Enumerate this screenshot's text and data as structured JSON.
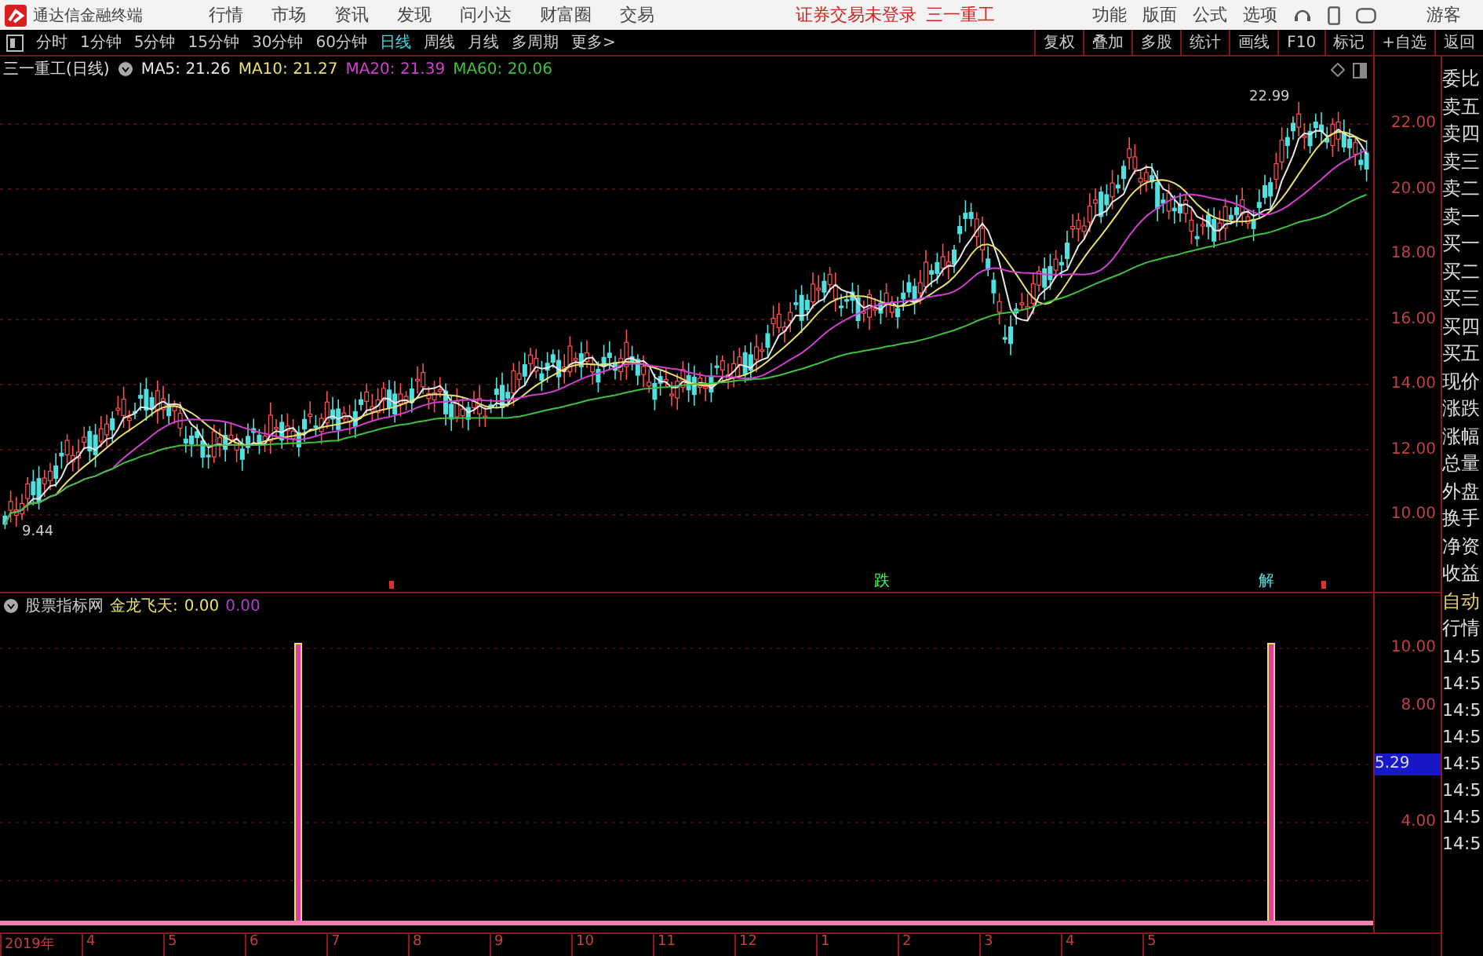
{
  "app": {
    "title": "通达信金融终端"
  },
  "menu": [
    "行情",
    "市场",
    "资讯",
    "发现",
    "问小达",
    "财富圈",
    "交易"
  ],
  "login_status": "证券交易未登录",
  "stock_name": "三一重工",
  "tools": [
    "功能",
    "版面",
    "公式",
    "选项"
  ],
  "user": "游客",
  "periods": [
    {
      "label": "分时",
      "selected": false
    },
    {
      "label": "1分钟",
      "selected": false
    },
    {
      "label": "5分钟",
      "selected": false
    },
    {
      "label": "15分钟",
      "selected": false
    },
    {
      "label": "30分钟",
      "selected": false
    },
    {
      "label": "60分钟",
      "selected": false
    },
    {
      "label": "日线",
      "selected": true
    },
    {
      "label": "周线",
      "selected": false
    },
    {
      "label": "月线",
      "selected": false
    },
    {
      "label": "多周期",
      "selected": false
    },
    {
      "label": "更多>",
      "selected": false
    }
  ],
  "actions": [
    "复权",
    "叠加",
    "多股",
    "统计",
    "画线",
    "F10",
    "标记",
    "+自选",
    "返回"
  ],
  "chart": {
    "title": "三一重工(日线)",
    "ma": [
      {
        "label": "MA5: 21.26",
        "color": "#e8e8e8"
      },
      {
        "label": "MA10: 21.27",
        "color": "#e8e070"
      },
      {
        "label": "MA20: 21.39",
        "color": "#d040d0"
      },
      {
        "label": "MA60: 20.06",
        "color": "#40c040"
      }
    ],
    "high_label": "22.99",
    "low_label": "9.44",
    "y_labels": [
      "22.00",
      "20.00",
      "18.00",
      "16.00",
      "14.00",
      "12.00",
      "10.00"
    ],
    "signals": [
      "跌",
      "解"
    ]
  },
  "indicator": {
    "source": "股票指标网",
    "name": "金龙飞天:",
    "value_1": "0.00",
    "value_2": "0.00",
    "y_labels": [
      {
        "label": "10.00",
        "kind": "tick"
      },
      {
        "label": "8.00",
        "kind": "tick"
      },
      {
        "label": "5.29",
        "kind": "current"
      },
      {
        "label": "4.00",
        "kind": "tick"
      }
    ]
  },
  "x_labels": [
    "2019年",
    "4",
    "5",
    "6",
    "7",
    "8",
    "9",
    "10",
    "11",
    "12",
    "1",
    "2",
    "3",
    "4",
    "5"
  ],
  "side_quote": [
    "委比",
    "卖五",
    "卖四",
    "卖三",
    "卖二",
    "卖一",
    "买一",
    "买二",
    "买三",
    "买四",
    "买五",
    "现价",
    "涨跌",
    "涨幅",
    "总量",
    "外盘",
    "换手",
    "净资",
    "收益"
  ],
  "side_mode": [
    {
      "label": "自动",
      "color": "#e8d060"
    },
    {
      "label": "行情",
      "color": "#e0e0e0"
    }
  ],
  "side_times": [
    "14:5",
    "14:5",
    "14:5",
    "14:5",
    "14:5",
    "14:5",
    "14:5",
    "14:5"
  ]
}
